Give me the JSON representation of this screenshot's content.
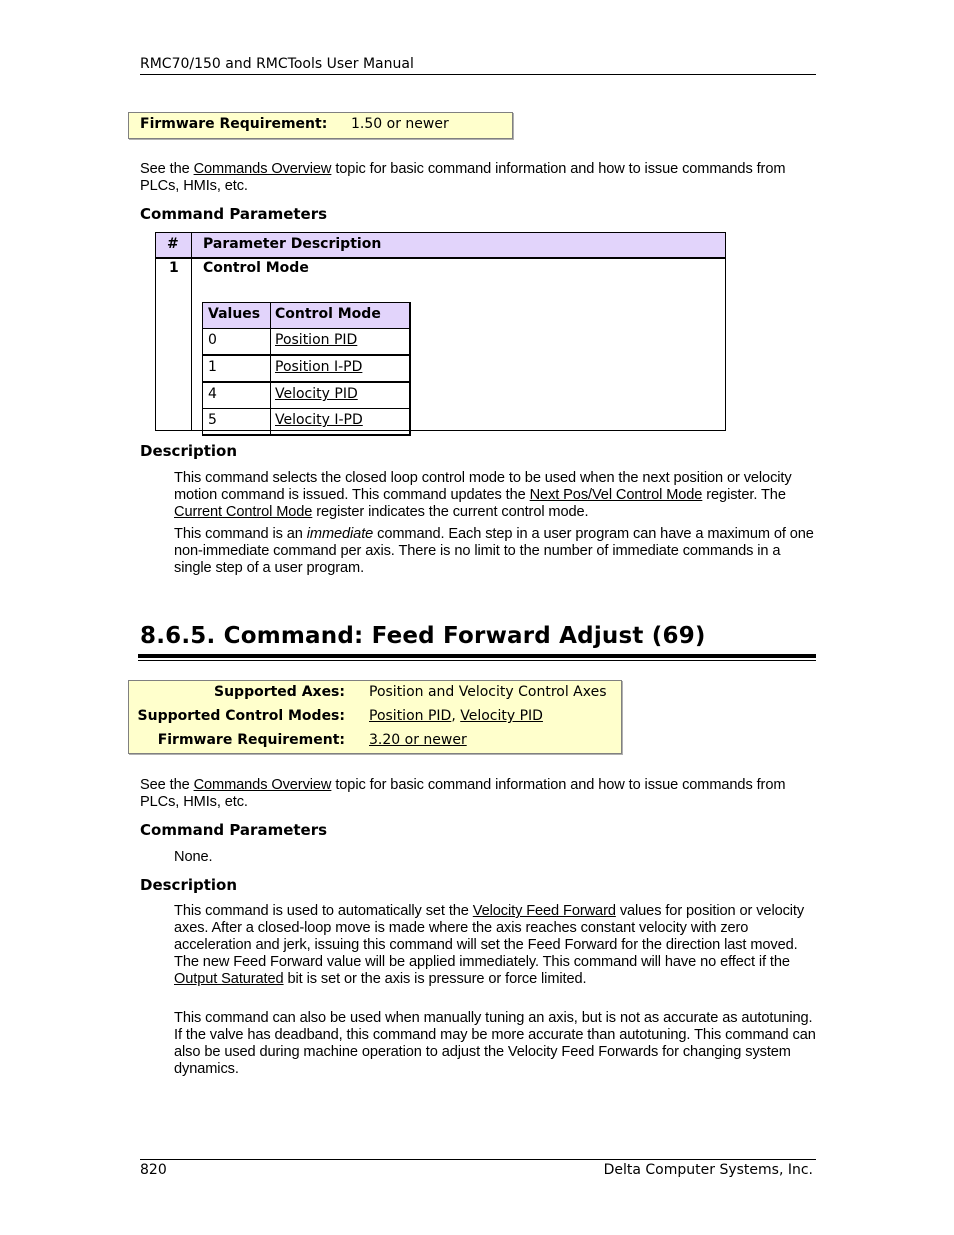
{
  "header": {
    "title": "RMC70/150 and RMCTools User Manual"
  },
  "section1": {
    "firmware": {
      "label": "Firmware Requirement:",
      "value": "1.50 or newer"
    },
    "see": {
      "pre": "See the ",
      "link": "Commands Overview",
      "post": " topic for basic command information and how to issue commands from PLCs, HMIs, etc."
    },
    "command_parameters_heading": "Command Parameters",
    "param_table": {
      "headers": [
        "#",
        "Parameter Description"
      ],
      "rows": [
        {
          "num": "1",
          "name": "Control Mode"
        }
      ],
      "values_table": {
        "headers": [
          "Values",
          "Control Mode"
        ],
        "rows": [
          {
            "value": "0",
            "mode": "Position PID"
          },
          {
            "value": "1",
            "mode": "Position I-PD"
          },
          {
            "value": "4",
            "mode": "Velocity PID"
          },
          {
            "value": "5",
            "mode": "Velocity I-PD"
          }
        ]
      }
    },
    "description_heading": "Description",
    "desc_p1": {
      "a": "This command selects the closed loop control mode to be used when the next position or velocity motion command is issued. This command updates the ",
      "link1": "Next Pos/Vel Control Mode",
      "b": " register. The ",
      "link2": "Current Control Mode",
      "c": " register indicates the current control mode."
    },
    "desc_p2": {
      "a": "This command is an ",
      "em": "immediate",
      "b": " command. Each step in a user program can have a maximum of one non-immediate command per axis. There is no limit to the number of immediate commands in a single step of a user program."
    }
  },
  "section2": {
    "title": "8.6.5. Command: Feed Forward Adjust (69)",
    "info": {
      "axes_label": "Supported Axes:",
      "axes_value": "Position and Velocity Control Axes",
      "modes_label": "Supported Control Modes:",
      "mode1": "Position PID",
      "mode_sep": ", ",
      "mode2": "Velocity PID",
      "firmware_label": "Firmware Requirement:",
      "firmware_value": "3.20 or newer"
    },
    "see": {
      "pre": "See the ",
      "link": "Commands Overview",
      "post": " topic for basic command information and how to issue commands from PLCs, HMIs, etc."
    },
    "command_parameters_heading": "Command Parameters",
    "parameters_none": "None.",
    "description_heading": "Description",
    "desc_p1": {
      "a": "This command is used to automatically set the ",
      "link1": "Velocity Feed Forward",
      "b": " values for position or velocity axes. After a closed-loop move is made where the axis reaches constant velocity with zero acceleration and jerk, issuing this command will set the Feed Forward for the direction last moved. The new Feed Forward value will be applied immediately. This command will have no effect if the ",
      "link2": "Output Saturated",
      "c": " bit is set or the axis is pressure or force limited."
    },
    "desc_p2": "This command can also be used when manually tuning an axis, but is not as accurate as autotuning. If the valve has deadband, this command may be more accurate than autotuning. This command can also be used during machine operation to adjust the Velocity Feed Forwards for changing system dynamics."
  },
  "footer": {
    "page_number": "820",
    "company": "Delta Computer Systems, Inc."
  }
}
